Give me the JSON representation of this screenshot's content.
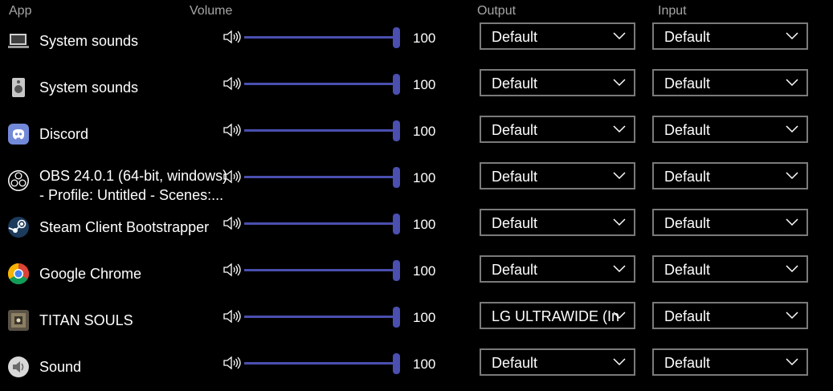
{
  "headers": {
    "app": "App",
    "volume": "Volume",
    "output": "Output",
    "input": "Input"
  },
  "rows": [
    {
      "name": "System sounds",
      "icon": "monitor-icon",
      "volume": "100",
      "output": "Default",
      "input": "Default"
    },
    {
      "name": "System sounds",
      "icon": "speaker-device-icon",
      "volume": "100",
      "output": "Default",
      "input": "Default"
    },
    {
      "name": "Discord",
      "icon": "discord-icon",
      "volume": "100",
      "output": "Default",
      "input": "Default"
    },
    {
      "name": "OBS 24.0.1 (64-bit, windows)\n- Profile: Untitled - Scenes:...",
      "icon": "obs-icon",
      "volume": "100",
      "output": "Default",
      "input": "Default"
    },
    {
      "name": "Steam Client Bootstrapper",
      "icon": "steam-icon",
      "volume": "100",
      "output": "Default",
      "input": "Default"
    },
    {
      "name": "Google Chrome",
      "icon": "chrome-icon",
      "volume": "100",
      "output": "Default",
      "input": "Default"
    },
    {
      "name": "TITAN SOULS",
      "icon": "titan-souls-icon",
      "volume": "100",
      "output": "LG ULTRAWIDE (Int",
      "input": "Default"
    },
    {
      "name": "Sound",
      "icon": "sound-icon",
      "volume": "100",
      "output": "Default",
      "input": "Default"
    }
  ],
  "colors": {
    "background": "#000000",
    "slider": "#4a4fb0",
    "header_text": "#a6a6a6",
    "dropdown_border": "#7a7a7a"
  }
}
